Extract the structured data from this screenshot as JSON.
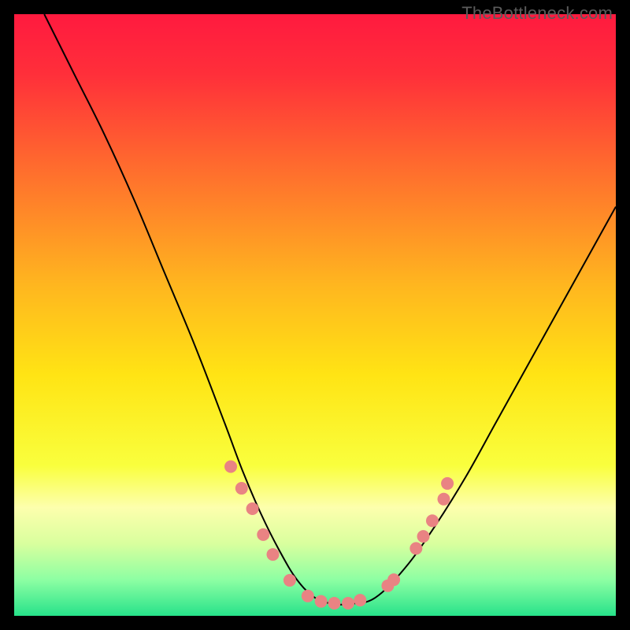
{
  "watermark": {
    "text": "TheBottleneck.com"
  },
  "chart_data": {
    "type": "line",
    "title": "",
    "xlabel": "",
    "ylabel": "",
    "xlim": [
      0,
      100
    ],
    "ylim": [
      0,
      100
    ],
    "grid": false,
    "legend": false,
    "background_gradient": {
      "stops": [
        {
          "pos": 0.0,
          "color": "#ff1a3f"
        },
        {
          "pos": 0.1,
          "color": "#ff2f3a"
        },
        {
          "pos": 0.25,
          "color": "#ff6a2e"
        },
        {
          "pos": 0.45,
          "color": "#ffb61f"
        },
        {
          "pos": 0.6,
          "color": "#ffe414"
        },
        {
          "pos": 0.75,
          "color": "#f9ff3d"
        },
        {
          "pos": 0.82,
          "color": "#fdffad"
        },
        {
          "pos": 0.88,
          "color": "#d9ff9e"
        },
        {
          "pos": 0.94,
          "color": "#8dffa3"
        },
        {
          "pos": 1.0,
          "color": "#27e28a"
        }
      ]
    },
    "series": [
      {
        "name": "bottleneck-curve",
        "stroke": "#000000",
        "stroke_width": 2,
        "x": [
          5,
          10,
          15,
          20,
          25,
          30,
          35,
          38,
          41,
          44,
          47,
          50,
          53,
          56,
          60,
          65,
          70,
          75,
          80,
          85,
          90,
          95,
          100
        ],
        "y": [
          100,
          90,
          80,
          69,
          57,
          45,
          32,
          24,
          17,
          11,
          6,
          3,
          2,
          2,
          3,
          8,
          15,
          23,
          32,
          41,
          50,
          59,
          68
        ]
      }
    ],
    "markers": {
      "name": "highlight-dots",
      "color": "#e98383",
      "radius_px": 8,
      "points": [
        {
          "x": 36.0,
          "y": 24.8
        },
        {
          "x": 37.8,
          "y": 21.2
        },
        {
          "x": 39.6,
          "y": 17.8
        },
        {
          "x": 41.4,
          "y": 13.5
        },
        {
          "x": 43.0,
          "y": 10.2
        },
        {
          "x": 45.8,
          "y": 5.9
        },
        {
          "x": 48.8,
          "y": 3.3
        },
        {
          "x": 51.0,
          "y": 2.4
        },
        {
          "x": 53.2,
          "y": 2.1
        },
        {
          "x": 55.5,
          "y": 2.1
        },
        {
          "x": 57.5,
          "y": 2.6
        },
        {
          "x": 62.1,
          "y": 5.0
        },
        {
          "x": 63.1,
          "y": 6.0
        },
        {
          "x": 66.8,
          "y": 11.2
        },
        {
          "x": 68.0,
          "y": 13.2
        },
        {
          "x": 69.5,
          "y": 15.8
        },
        {
          "x": 71.4,
          "y": 19.4
        },
        {
          "x": 72.0,
          "y": 22.0
        }
      ]
    }
  }
}
